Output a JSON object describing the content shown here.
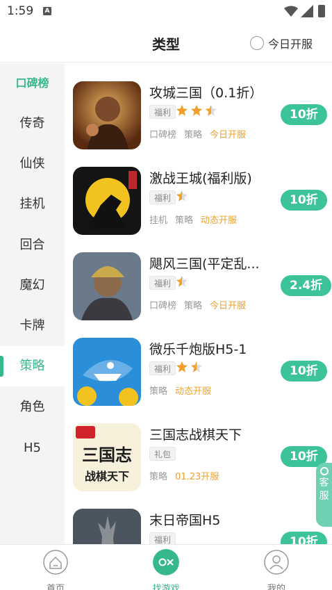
{
  "status_bar": {
    "time": "1:59"
  },
  "header": {
    "title": "类型",
    "today_open_label": "今日开服"
  },
  "sidebar": {
    "items": [
      {
        "label": "口碑榜"
      },
      {
        "label": "传奇"
      },
      {
        "label": "仙侠"
      },
      {
        "label": "挂机"
      },
      {
        "label": "回合"
      },
      {
        "label": "魔幻"
      },
      {
        "label": "卡牌"
      },
      {
        "label": "策略"
      },
      {
        "label": "角色"
      },
      {
        "label": "H5"
      }
    ],
    "active_label": "策略"
  },
  "games": [
    {
      "name": "攻城三国（0.1折）",
      "tag": "福利",
      "rating": 2.5,
      "meta": [
        "口碑榜",
        "策略"
      ],
      "open": "今日开服",
      "discount": "10折"
    },
    {
      "name": "激战王城(福利版)",
      "tag": "福利",
      "rating": 0.5,
      "meta": [
        "挂机",
        "策略"
      ],
      "open": "动态开服",
      "discount": "10折"
    },
    {
      "name": "飓风三国(平定乱...",
      "tag": "福利",
      "rating": 0.5,
      "meta": [
        "口碑榜",
        "策略"
      ],
      "open": "今日开服",
      "discount": "2.4折"
    },
    {
      "name": "微乐千炮版H5-1",
      "tag": "福利",
      "rating": 1.5,
      "meta": [
        "策略"
      ],
      "open": "动态开服",
      "discount": "10折"
    },
    {
      "name": "三国志战棋天下",
      "tag": "礼包",
      "rating": 0,
      "meta": [
        "策略"
      ],
      "open": "01.23开服",
      "discount": "10折"
    },
    {
      "name": "末日帝国H5",
      "tag": "福利",
      "rating": 0,
      "meta": [],
      "open": "",
      "discount": "10折"
    }
  ],
  "float_service": {
    "label1": "客",
    "label2": "服"
  },
  "tabbar": {
    "home": "首页",
    "find": "找游戏",
    "mine": "我的"
  },
  "colors": {
    "accent": "#35b98c",
    "open_text": "#f0a02d",
    "star": "#f0a02d"
  }
}
